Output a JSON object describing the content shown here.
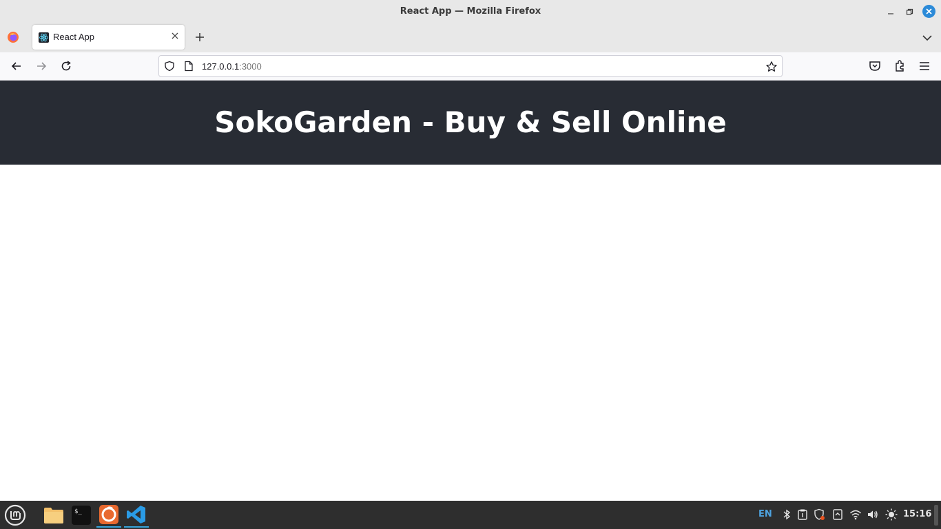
{
  "window": {
    "title": "React App — Mozilla Firefox"
  },
  "tabs": [
    {
      "label": "React App",
      "favicon": "react-icon",
      "active": true
    }
  ],
  "navbar": {
    "url_host": "127.0.0.1",
    "url_port": ":3000"
  },
  "page": {
    "header_title": "SokoGarden - Buy & Sell Online",
    "header_bg": "#282c34",
    "header_color": "#ffffff"
  },
  "taskbar": {
    "apps": [
      "menu-icon",
      "files-icon",
      "terminal-icon",
      "firefox-icon",
      "vscode-icon"
    ],
    "lang": "EN",
    "clock": "15:16",
    "accent": "#36a3d9"
  }
}
